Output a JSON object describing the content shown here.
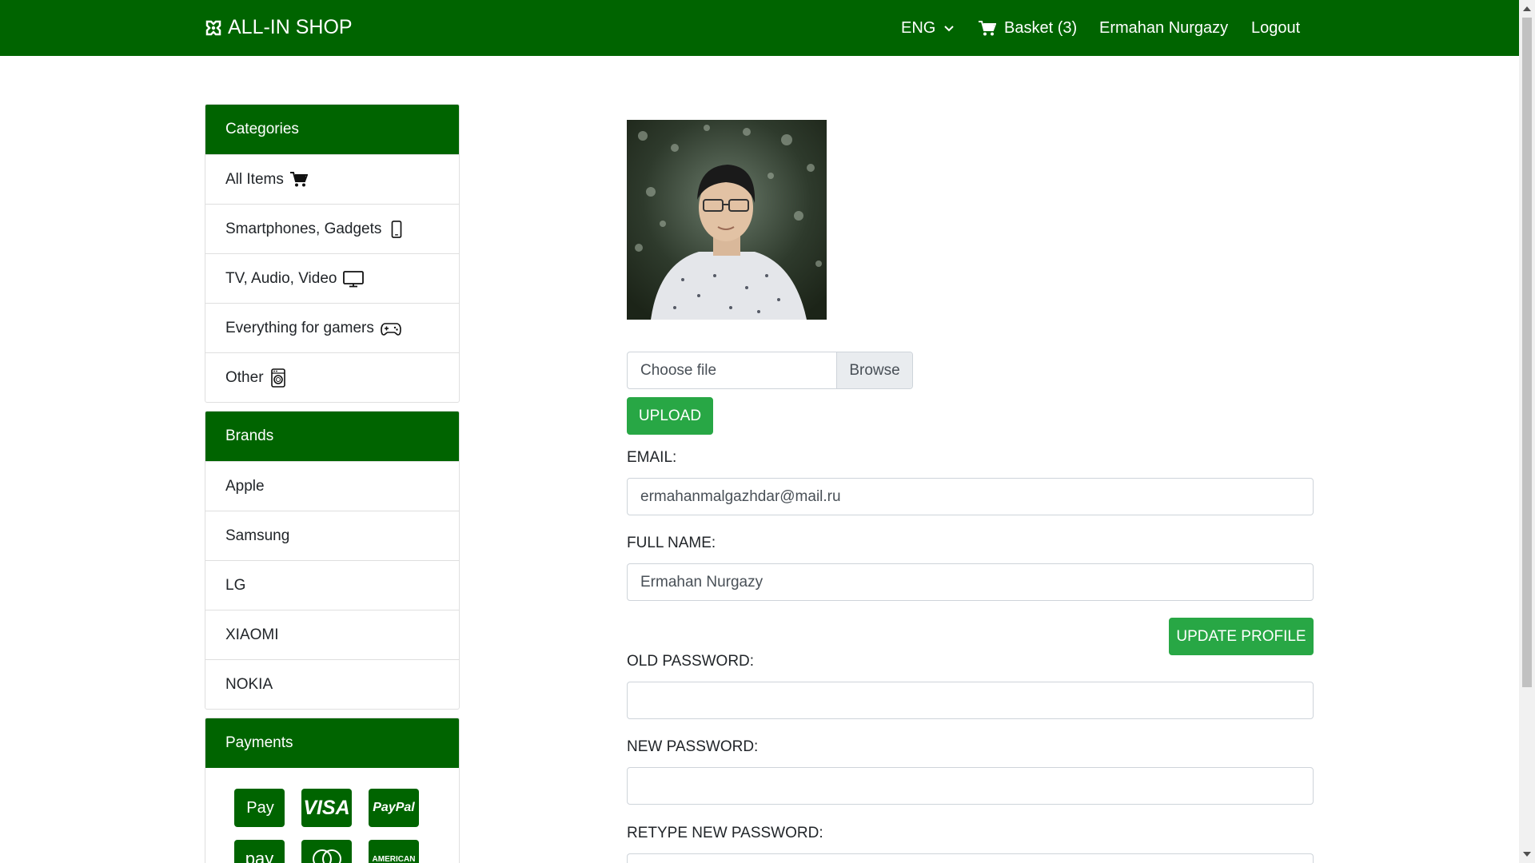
{
  "navbar": {
    "brand": "ALL-IN SHOP",
    "brand_icon": "joomla-icon",
    "language": "ENG",
    "basket": "Basket (3)",
    "user": "Ermahan Nurgazy",
    "logout": "Logout",
    "bg_color": "#006400"
  },
  "sidebar": {
    "categories": {
      "title": "Categories",
      "items": [
        {
          "label": "All Items",
          "icon": "cart-icon"
        },
        {
          "label": "Smartphones, Gadgets",
          "icon": "phone-icon"
        },
        {
          "label": "TV, Audio, Video",
          "icon": "monitor-icon"
        },
        {
          "label": "Everything for gamers",
          "icon": "gamepad-icon"
        },
        {
          "label": "Other",
          "icon": "washing-machine-icon"
        }
      ]
    },
    "brands": {
      "title": "Brands",
      "items": [
        "Apple",
        "Samsung",
        "LG",
        "XIAOMI",
        "NOKIA"
      ]
    },
    "payments": {
      "title": "Payments",
      "logos": [
        "Pay",
        "VISA",
        "PayPal",
        "pay",
        "mastercard",
        "AMERICAN"
      ]
    }
  },
  "profile": {
    "file_placeholder": "Choose file",
    "browse_label": "Browse",
    "upload_label": "UPLOAD",
    "email_label": "EMAIL:",
    "email_value": "ermahanmalgazhdar@mail.ru",
    "fullname_label": "FULL NAME:",
    "fullname_value": "Ermahan Nurgazy",
    "update_label": "UPDATE PROFILE",
    "old_password_label": "OLD PASSWORD:",
    "new_password_label": "NEW PASSWORD:",
    "retype_password_label": "RETYPE NEW PASSWORD:",
    "accent_color": "#28a745"
  }
}
